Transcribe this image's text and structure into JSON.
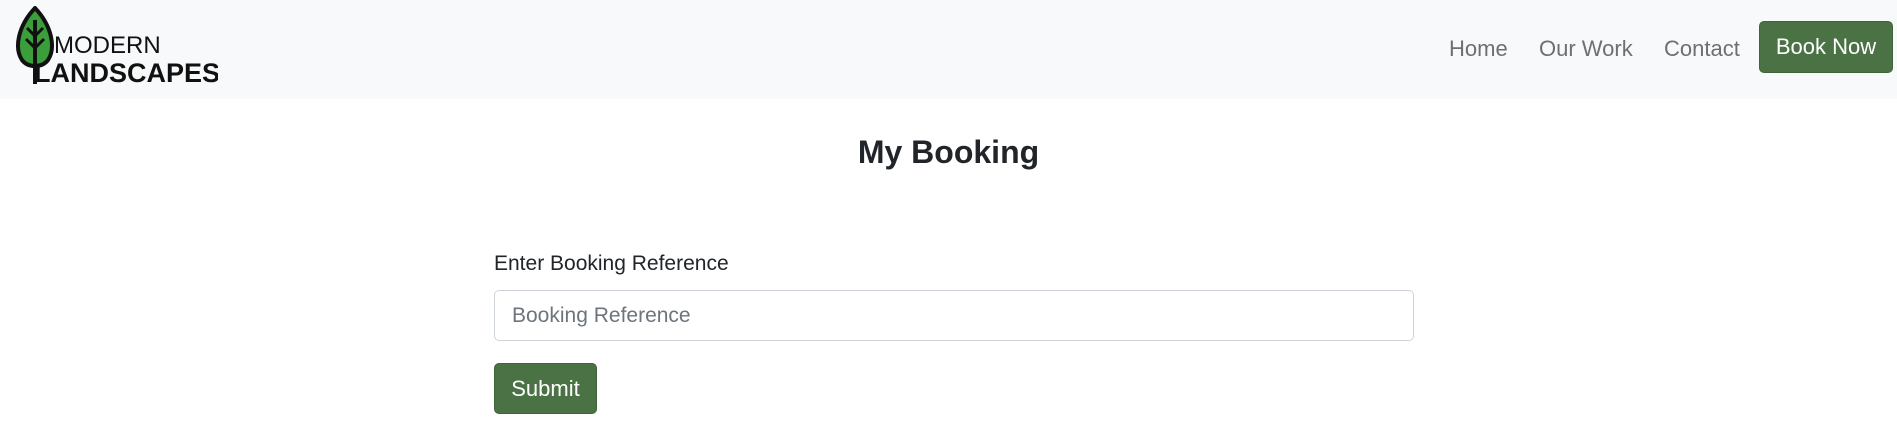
{
  "brand": {
    "line1": "MODERN",
    "line2": "LANDSCAPES",
    "leaf_color": "#3a9e3a",
    "outline_color": "#111111"
  },
  "nav": {
    "items": [
      {
        "label": "Home"
      },
      {
        "label": "Our Work"
      },
      {
        "label": "Contact"
      }
    ],
    "cta_label": "Book Now"
  },
  "main": {
    "title": "My Booking",
    "form": {
      "label": "Enter Booking Reference",
      "input_placeholder": "Booking Reference",
      "input_value": "",
      "submit_label": "Submit"
    }
  },
  "colors": {
    "navbar_bg": "#f8f9fa",
    "primary_button": "#4a7245",
    "nav_text": "#6f6f6f",
    "heading_text": "#212529"
  }
}
